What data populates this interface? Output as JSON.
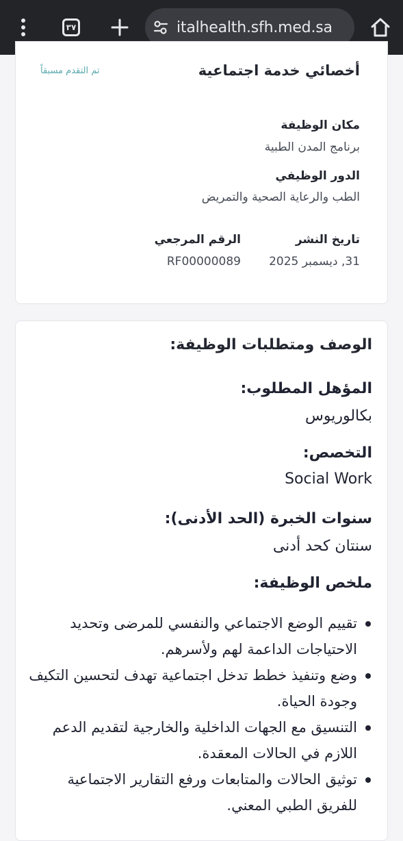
{
  "browser": {
    "tab_count": "٣٧",
    "url": "italhealth.sfh.med.sa",
    "icons": [
      "more-vert-icon",
      "tabs-icon",
      "plus-icon",
      "site-settings-icon",
      "home-icon"
    ]
  },
  "job_header": {
    "title": "أخصائي خدمة اجتماعية",
    "applied_status": "تم التقدم مسبقاً",
    "location_label": "مكان الوظيفة",
    "location_value": "برنامج المدن الطبية",
    "role_label": "الدور الوظيفي",
    "role_value": "الطب والرعاية الصحية والتمريض",
    "posted_label": "تاريخ النشر",
    "posted_value": "31, ديسمبر 2025",
    "ref_label": "الرقم المرجعي",
    "ref_value": "RF00000089"
  },
  "description": {
    "section_title": "الوصف ومتطلبات الوظيفة:",
    "qualification_label": "المؤهل المطلوب:",
    "qualification_value": "بكالوريوس",
    "specialty_label": "التخصص:",
    "specialty_value": "Social Work",
    "experience_label": "سنوات الخبرة (الحد الأدنى):",
    "experience_value": "سنتان كحد أدنى",
    "summary_label": "ملخص الوظيفة:",
    "duties": [
      "تقييم الوضع الاجتماعي والنفسي للمرضى وتحديد الاحتياجات الداعمة لهم ولأسرهم.",
      "وضع وتنفيذ خطط تدخل اجتماعية تهدف لتحسين التكيف وجودة الحياة.",
      "التنسيق مع الجهات الداخلية والخارجية لتقديم الدعم اللازم في الحالات المعقدة.",
      "توثيق الحالات والمتابعات ورفع التقارير الاجتماعية للفريق الطبي المعني."
    ]
  },
  "colors": {
    "browser_bar": "#232428",
    "url_bar": "#3b3c41",
    "applied_tag": "#5aa9ad",
    "page_bg": "#f5f5f7"
  }
}
